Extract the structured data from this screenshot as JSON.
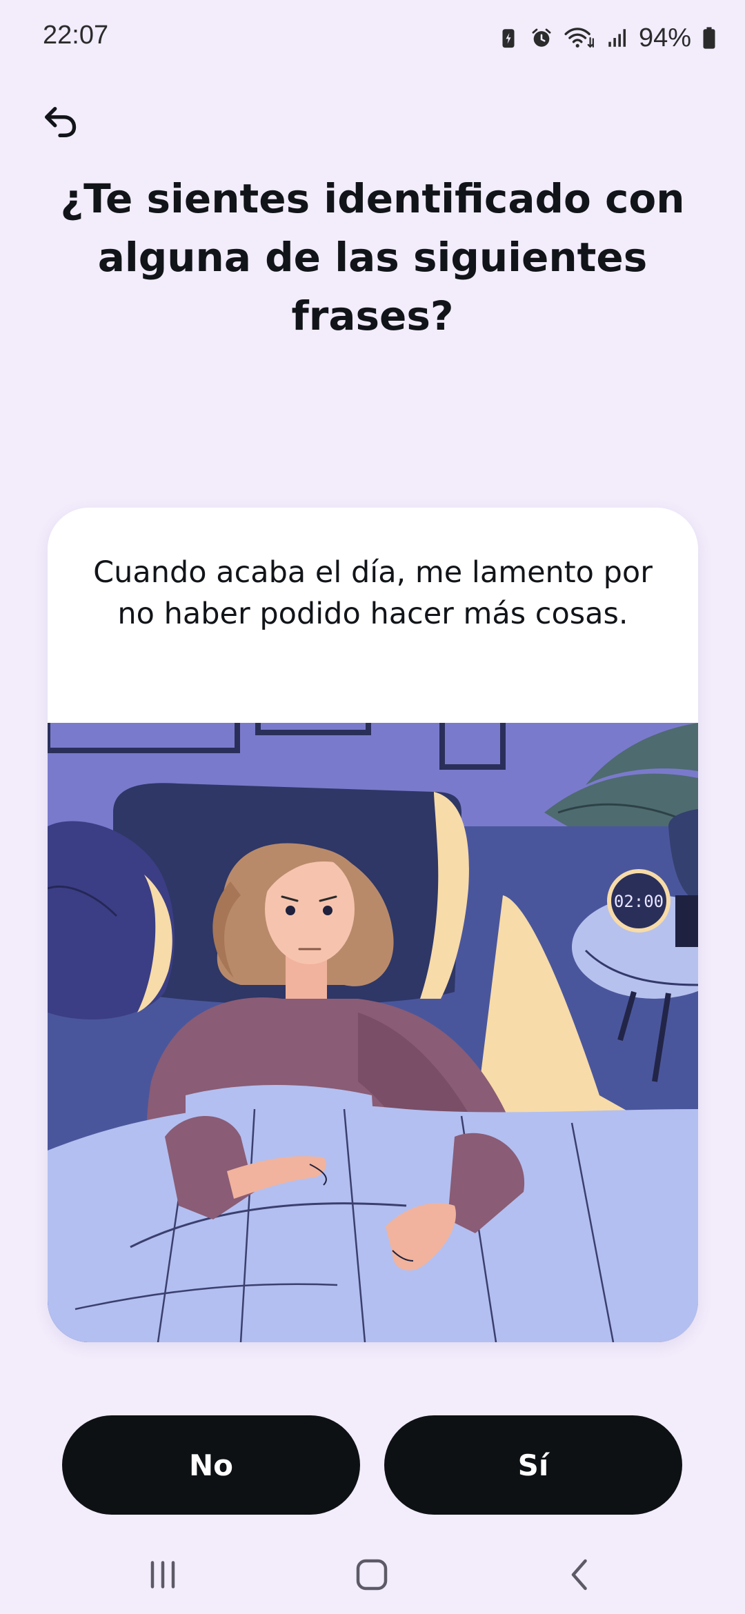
{
  "status_bar": {
    "time": "22:07",
    "battery_percent": "94%",
    "icons": [
      "battery-saver-icon",
      "alarm-icon",
      "wifi-icon",
      "signal-icon",
      "battery-icon"
    ]
  },
  "header": {
    "back_icon": "back-arrow-icon",
    "title": "¿Te sientes identificado con alguna de las siguientes frases?"
  },
  "card": {
    "statement": "Cuando acaba el día, me lamento por no haber podido hacer más cosas.",
    "illustration_clock": "02:00"
  },
  "answers": {
    "no_label": "No",
    "yes_label": "Sí"
  },
  "nav_bar": {
    "icons": [
      "recent-apps-icon",
      "home-icon",
      "back-icon"
    ]
  },
  "colors": {
    "background": "#f2ecfb",
    "card": "#ffffff",
    "button": "#0e1114",
    "button_text": "#ffffff",
    "text": "#111418"
  }
}
